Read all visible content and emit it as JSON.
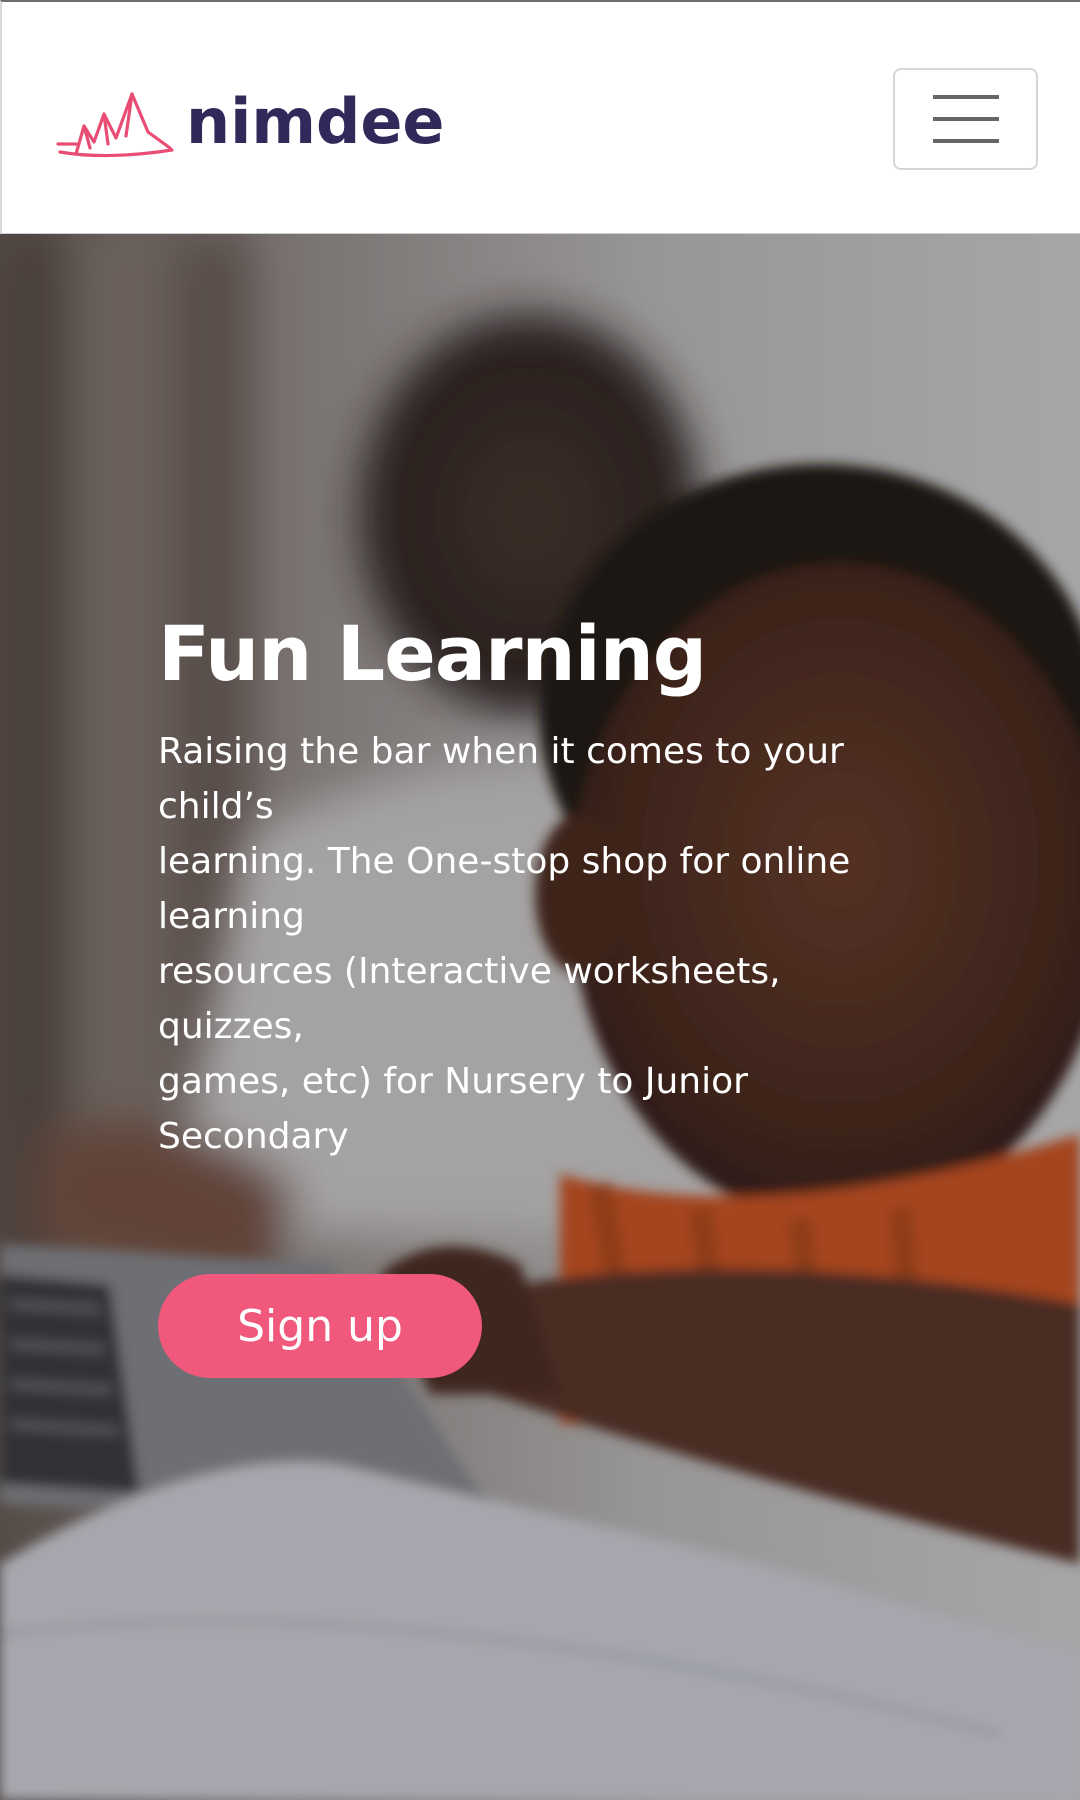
{
  "header": {
    "logo_text": "nimdee",
    "menu_icon": "hamburger-menu-icon"
  },
  "hero": {
    "title": "Fun Learning",
    "description_lines": [
      "Raising the bar when it comes to your",
      "child’s",
      "learning. The One-stop shop for online",
      "learning",
      "resources (Interactive worksheets,",
      "quizzes,",
      "games, etc) for Nursery to Junior",
      "Secondary"
    ],
    "signup_label": "Sign up"
  },
  "colors": {
    "brand_pink": "#f0587c",
    "logo_text": "#2f2a5a",
    "logo_mark": "#e94d73"
  }
}
